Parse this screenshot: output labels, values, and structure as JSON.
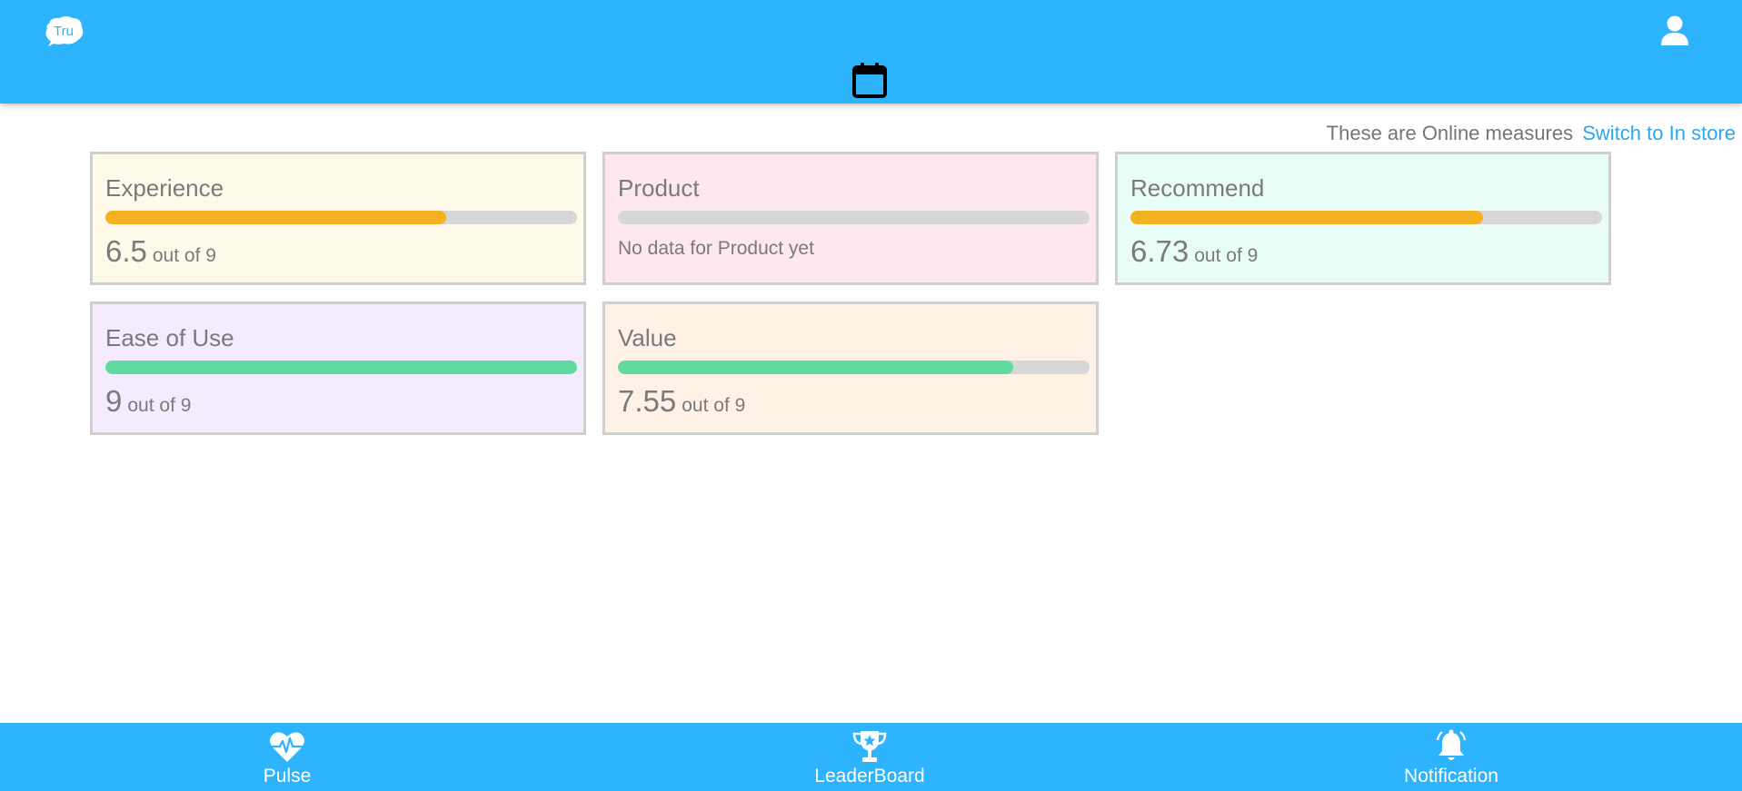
{
  "header": {
    "logo_text": "Tru",
    "logo_icon": "tru-logo-icon",
    "user_icon": "user-icon",
    "calendar_icon": "calendar-icon"
  },
  "measures": {
    "info_text": "These are Online measures",
    "switch_label": "Switch to In store"
  },
  "cards": [
    {
      "title": "Experience",
      "score": "6.5",
      "suffix": "out of 9",
      "fill": 0.722,
      "bar_color": "#f4b122",
      "bg": "#fefae9"
    },
    {
      "title": "Product",
      "no_data": "No data for Product yet",
      "fill": 0,
      "bar_color": "#f4b122",
      "bg": "#fee7ee"
    },
    {
      "title": "Recommend",
      "score": "6.73",
      "suffix": "out of 9",
      "fill": 0.748,
      "bar_color": "#f4b122",
      "bg": "#e7fdf5"
    },
    {
      "title": "Ease of Use",
      "score": "9",
      "suffix": "out of 9",
      "fill": 1.0,
      "bar_color": "#5fdba2",
      "bg": "#f4ecfe"
    },
    {
      "title": "Value",
      "score": "7.55",
      "suffix": "out of 9",
      "fill": 0.839,
      "bar_color": "#5fdba2",
      "bg": "#fef2e7"
    }
  ],
  "bottom_nav": [
    {
      "label": "Pulse",
      "icon": "heart-pulse-icon"
    },
    {
      "label": "LeaderBoard",
      "icon": "trophy-icon"
    },
    {
      "label": "Notification",
      "icon": "bell-icon"
    }
  ],
  "colors": {
    "brand_blue": "#2db4fc",
    "link_blue": "#2ba8f0",
    "text_gray": "#7a7a7a"
  }
}
